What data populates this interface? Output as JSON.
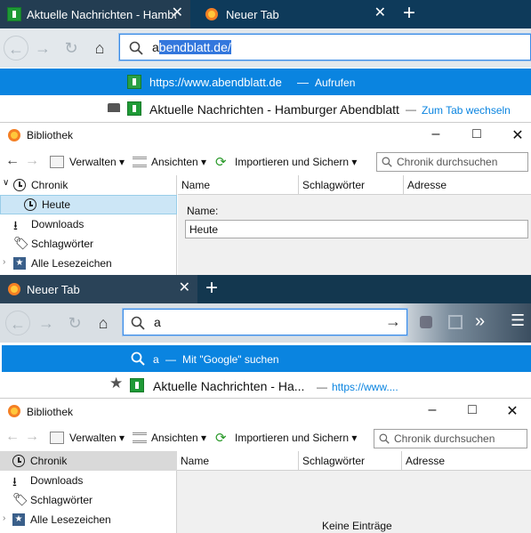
{
  "panel1": {
    "tabs": [
      {
        "label": "Aktuelle Nachrichten - Hamburg"
      },
      {
        "label": "Neuer Tab"
      }
    ],
    "url": {
      "typed": "a",
      "completion": "bendblatt.de/"
    },
    "suggestion_primary": {
      "url": "https://www.abendblatt.de",
      "sep": "—",
      "action": "Aufrufen"
    },
    "suggestion_secondary": {
      "title": "Aktuelle Nachrichten - Hamburger Abendblatt",
      "sep": "—",
      "action": "Zum Tab wechseln"
    }
  },
  "library1": {
    "title": "Bibliothek",
    "toolbar": {
      "manage": "Verwalten",
      "views": "Ansichten",
      "import": "Importieren und Sichern",
      "search_placeholder": "Chronik durchsuchen"
    },
    "tree": [
      "Chronik",
      "Heute",
      "Downloads",
      "Schlagwörter",
      "Alle Lesezeichen"
    ],
    "columns": [
      "Name",
      "Schlagwörter",
      "Adresse"
    ],
    "detail": {
      "name_label": "Name:",
      "name_value": "Heute"
    }
  },
  "panel2": {
    "tab": {
      "label": "Neuer Tab"
    },
    "url": {
      "typed": "a"
    },
    "suggestion_primary": {
      "query": "a",
      "sep": "—",
      "action": "Mit \"Google\" suchen"
    },
    "suggestion_secondary": {
      "title": "Aktuelle Nachrichten - Ha...",
      "sep": "—",
      "url": "https://www...."
    }
  },
  "library2": {
    "title": "Bibliothek",
    "toolbar": {
      "manage": "Verwalten",
      "views": "Ansichten",
      "import": "Importieren und Sichern",
      "search_placeholder": "Chronik durchsuchen"
    },
    "tree": [
      "Chronik",
      "Downloads",
      "Schlagwörter",
      "Alle Lesezeichen"
    ],
    "columns": [
      "Name",
      "Schlagwörter",
      "Adresse"
    ],
    "empty": "Keine Einträge"
  },
  "colors": {
    "accent": "#0a84e0",
    "tabbar": "#0e3a5a",
    "navbar": "#e3e8ec",
    "tree_selected": "#cce6f6"
  }
}
